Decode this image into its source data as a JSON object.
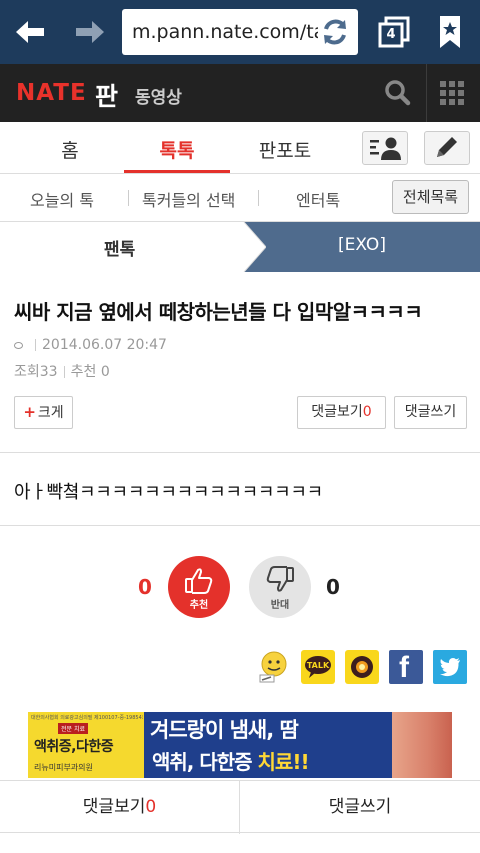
{
  "browser": {
    "url": "m.pann.nate.com/ta",
    "tab_count": "4"
  },
  "header": {
    "logo": "NATE",
    "title": "판",
    "video_link": "동영상"
  },
  "main_tabs": [
    {
      "label": "홈"
    },
    {
      "label": "톡톡"
    },
    {
      "label": "판포토"
    }
  ],
  "sub_tabs": [
    {
      "label": "오늘의 톡"
    },
    {
      "label": "톡커들의 선택"
    },
    {
      "label": "엔터톡"
    }
  ],
  "all_list_label": "전체목록",
  "breadcrumb": {
    "category": "팬톡",
    "subcategory": "[EXO]"
  },
  "post": {
    "title": "씨바 지금 옆에서 떼창하는년들 다 입막알ㅋㅋㅋㅋ",
    "date": "2014.06.07 20:47",
    "views_label": "조회",
    "views": "33",
    "recommend_label": "추천",
    "recommend": "0",
    "bigger_label": "크게",
    "comments_view_label": "댓글보기",
    "comments_count": "0",
    "comment_write_label": "댓글쓰기",
    "body": "아ㅏ빡쳨ㅋㅋㅋㅋㅋㅋㅋㅋㅋㅋㅋㅋㅋㅋㅋ"
  },
  "votes": {
    "up_count": "0",
    "up_label": "추천",
    "down_label": "반대",
    "down_count": "0"
  },
  "share_icons": [
    "cyworld-icon",
    "kakaotalk-icon",
    "kakaostory-icon",
    "facebook-icon",
    "twitter-icon"
  ],
  "share": {
    "talk_label": "TALK",
    "fb_letter": "f"
  },
  "ad": {
    "fine_print": "대한의사협회 의료광고심의필 제100107-중-19854호",
    "badge": "전문 치료",
    "left_main": "액취증,다한증",
    "clinic": "리뉴미피부과의원",
    "line1": "겨드랑이 냄새, 땀",
    "line2_prefix": "액취, 다한증 ",
    "line2_highlight": "치료!!"
  },
  "bottom": {
    "comments_view_label": "댓글보기",
    "comments_count": "0",
    "comment_write_label": "댓글쓰기"
  },
  "colors": {
    "browser_bar": "#1e3b5c",
    "nate_red": "#e4312b",
    "header_bg": "#222222",
    "breadcrumb_bg": "#4f6b8d"
  }
}
